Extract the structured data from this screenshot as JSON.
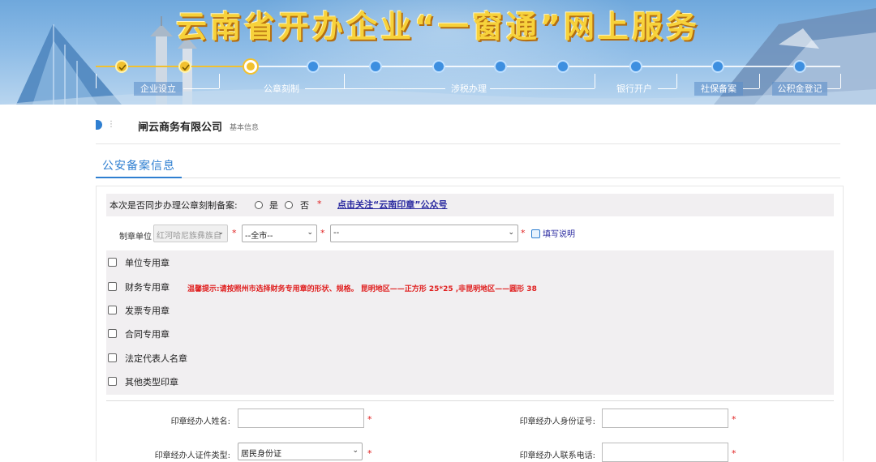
{
  "banner": {
    "title": "云南省开办企业“一窗通”网上服务",
    "steps": [
      {
        "label": "企业设立",
        "state": "done"
      },
      {
        "label": "公章刻制",
        "state": "current"
      },
      {
        "label": "涉税办理",
        "state": "todo"
      },
      {
        "label": "银行开户",
        "state": "todo"
      },
      {
        "label": "社保备案",
        "state": "todo"
      },
      {
        "label": "公积金登记",
        "state": "todo"
      }
    ],
    "colors": {
      "done": "#f2c12e",
      "todo": "#3d8fe0",
      "title": "#f7d23b"
    }
  },
  "company": {
    "name": "闸云商务有限公司",
    "sub": "基本信息",
    "dots": "⋮"
  },
  "tab": {
    "label": "公安备案信息"
  },
  "sync": {
    "question": "本次是否同步办理公章刻制备案:",
    "yes": "是",
    "no": "否",
    "required": "*",
    "follow_link": "点击关注“云南印章”公众号"
  },
  "unit": {
    "label": "制章单位",
    "prefecture": "红河哈尼族彝族自",
    "city": "--全市--",
    "bureau": "--",
    "guide": "填写说明",
    "required": "*"
  },
  "seals": [
    {
      "label": "单位专用章",
      "checked": false
    },
    {
      "label": "财务专用章",
      "checked": false
    },
    {
      "label": "发票专用章",
      "checked": false
    },
    {
      "label": "合同专用章",
      "checked": false
    },
    {
      "label": "法定代表人名章",
      "checked": false
    },
    {
      "label": "其他类型印章",
      "checked": false
    }
  ],
  "warning": "温馨提示:请按照州市选择财务专用章的形状、规格。 昆明地区——正方形 25*25 ,非昆明地区——圆形 38",
  "handler": {
    "name_label": "印章经办人姓名:",
    "name_value": "",
    "id_label": "印章经办人身份证号:",
    "id_value": "",
    "cert_type_label": "印章经办人证件类型:",
    "cert_type_value": "居民身份证",
    "phone_label": "印章经办人联系电话:",
    "phone_value": "",
    "required": "*"
  }
}
